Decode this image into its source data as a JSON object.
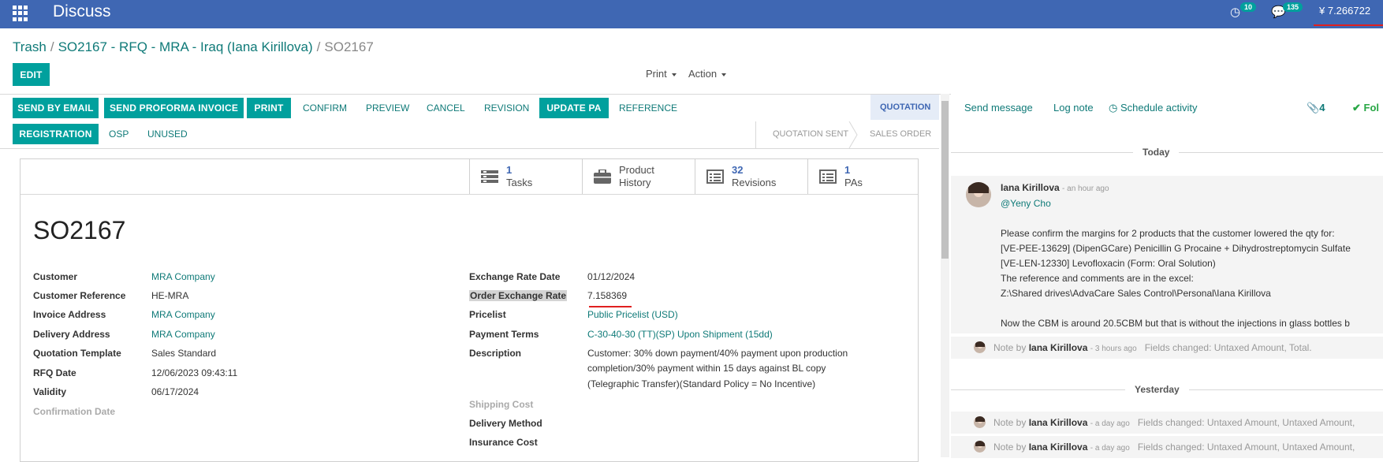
{
  "topbar": {
    "app_title": "Discuss",
    "activity_count": "10",
    "messages_count": "135",
    "currency_rate": "¥ 7.266722",
    "icons": [
      "apps-grid-icon",
      "activity-clock-icon",
      "chat-bubbles-icon"
    ],
    "bg_color": "#3f67b3"
  },
  "breadcrumb": {
    "items": [
      "Trash",
      "SO2167 - RFQ - MRA - Iraq (Iana Kirillova)"
    ],
    "current": "SO2167",
    "separator": "/"
  },
  "controls": {
    "edit": "EDIT",
    "print": "Print",
    "action": "Action"
  },
  "actions": {
    "row1": [
      "SEND BY EMAIL",
      "SEND PROFORMA INVOICE",
      "PRINT",
      "CONFIRM",
      "PREVIEW",
      "CANCEL",
      "REVISION",
      "UPDATE PA",
      "REFERENCE"
    ],
    "row2": [
      "REGISTRATION",
      "OSP",
      "UNUSED"
    ]
  },
  "statusbar": {
    "stages": [
      "QUOTATION",
      "QUOTATION SENT",
      "SALES ORDER"
    ],
    "active": "QUOTATION"
  },
  "smart_buttons": [
    {
      "count": "1",
      "label": "Tasks",
      "icon": "tasks-icon"
    },
    {
      "count": "",
      "label1": "Product",
      "label2": "History",
      "icon": "briefcase-icon"
    },
    {
      "count": "32",
      "label": "Revisions",
      "icon": "list-icon"
    },
    {
      "count": "1",
      "label": "PAs",
      "icon": "list-icon"
    }
  ],
  "record": {
    "name": "SO2167",
    "left": {
      "customer": {
        "label": "Customer",
        "value": "MRA Company"
      },
      "customer_ref": {
        "label": "Customer Reference",
        "value": "HE-MRA"
      },
      "invoice_addr": {
        "label": "Invoice Address",
        "value": "MRA Company"
      },
      "delivery_addr": {
        "label": "Delivery Address",
        "value": "MRA Company"
      },
      "template": {
        "label": "Quotation Template",
        "value": "Sales Standard"
      },
      "rfq_date": {
        "label": "RFQ Date",
        "value": "12/06/2023 09:43:11"
      },
      "validity": {
        "label": "Validity",
        "value": "06/17/2024"
      },
      "confirmation_date": {
        "label": "Confirmation Date",
        "value": ""
      }
    },
    "right": {
      "exchange_date": {
        "label": "Exchange Rate Date",
        "value": "01/12/2024"
      },
      "order_rate": {
        "label": "Order Exchange Rate",
        "value": "7.158369"
      },
      "pricelist": {
        "label": "Pricelist",
        "value": "Public Pricelist (USD)"
      },
      "payment_terms": {
        "label": "Payment Terms",
        "value": "C-30-40-30 (TT)(SP) Upon Shipment (15dd)"
      },
      "description": {
        "label": "Description",
        "line1": "Customer: 30% down payment/40% payment upon production",
        "line2": "completion/30% payment within 15 days against BL copy",
        "line3": "(Telegraphic Transfer)(Standard Policy = No Incentive)"
      },
      "shipping_cost": {
        "label": "Shipping Cost"
      },
      "delivery_method": {
        "label": "Delivery Method"
      },
      "insurance_cost": {
        "label": "Insurance Cost"
      }
    }
  },
  "chatter": {
    "send_message": "Send message",
    "log_note": "Log note",
    "schedule": "Schedule activity",
    "attachments": "4",
    "follow": "Fol",
    "today": "Today",
    "yesterday": "Yesterday",
    "message": {
      "author": "Iana Kirillova",
      "ago": "- an hour ago",
      "mention": "@Yeny Cho",
      "lines": [
        "Please confirm the margins for 2 products that the customer lowered the qty for:",
        "[VE-PEE-13629] (DipenGCare) Penicillin G Procaine + Dihydrostreptomycin Sulfate",
        "[VE-LEN-12330] Levofloxacin (Form: Oral Solution)",
        "The reference and comments are in the excel:",
        "Z:\\Shared drives\\AdvaCare Sales Control\\Personal\\Iana Kirillova",
        "Now the CBM is around 20.5CBM but that is without the injections in glass bottles b"
      ]
    },
    "notes": [
      {
        "prefix": "Note by",
        "author": "Iana Kirillova",
        "ago": "- 3 hours ago",
        "text": "Fields changed: Untaxed Amount, Total."
      },
      {
        "prefix": "Note by",
        "author": "Iana Kirillova",
        "ago": "- a day ago",
        "text": "Fields changed: Untaxed Amount, Untaxed Amount,"
      },
      {
        "prefix": "Note by",
        "author": "Iana Kirillova",
        "ago": "- a day ago",
        "text": "Fields changed: Untaxed Amount, Untaxed Amount,"
      }
    ]
  }
}
